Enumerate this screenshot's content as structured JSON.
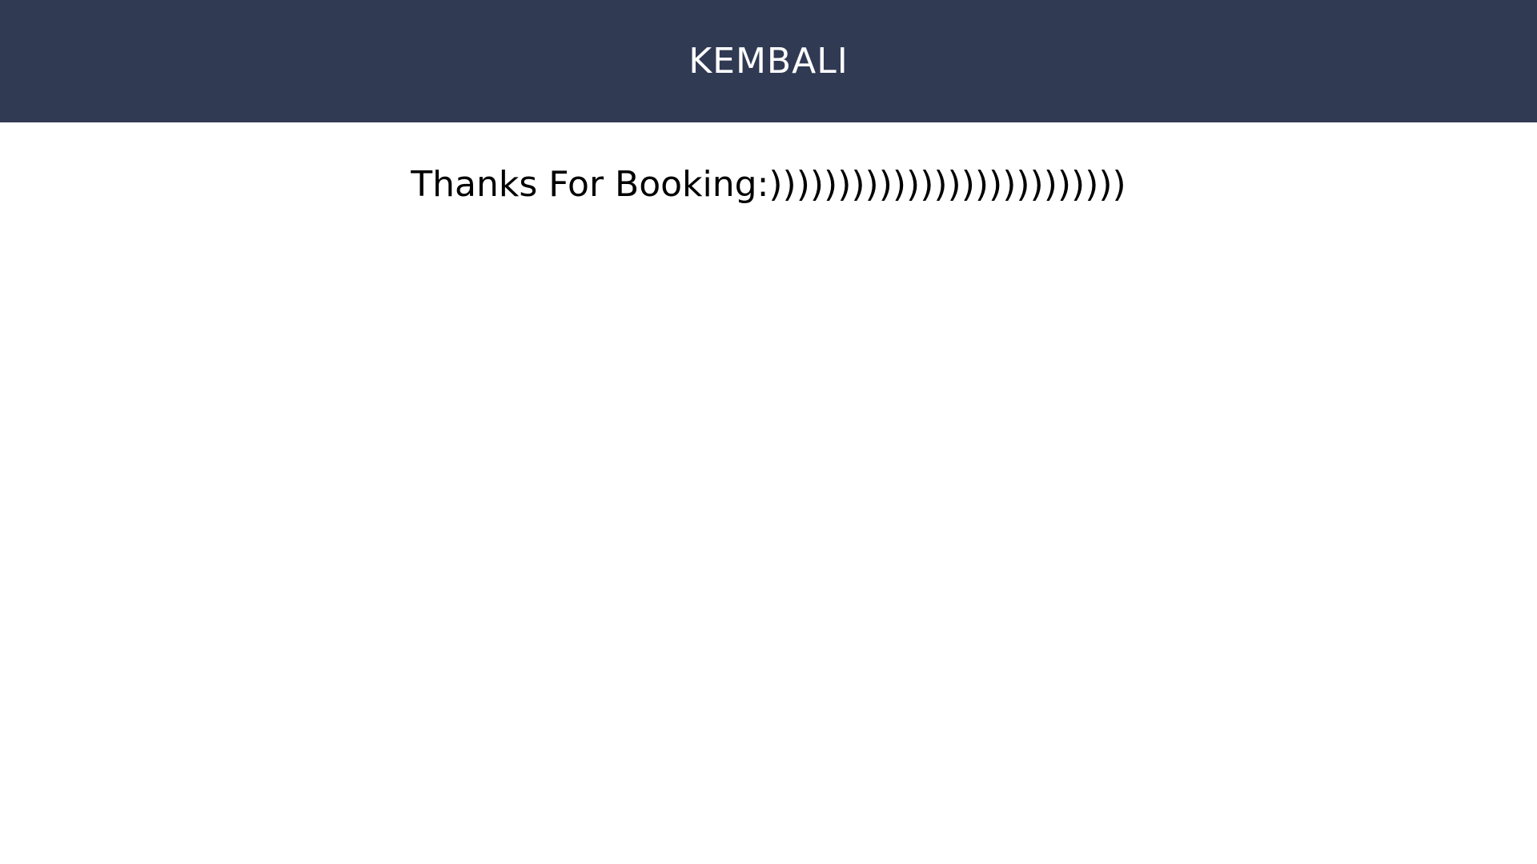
{
  "header": {
    "back_label": "KEMBALI"
  },
  "main": {
    "message": "Thanks For Booking:))))))))))))))))))))))))))"
  },
  "colors": {
    "header_background": "#313a53",
    "header_text": "#ffffff",
    "body_background": "#ffffff",
    "body_text": "#000000"
  }
}
